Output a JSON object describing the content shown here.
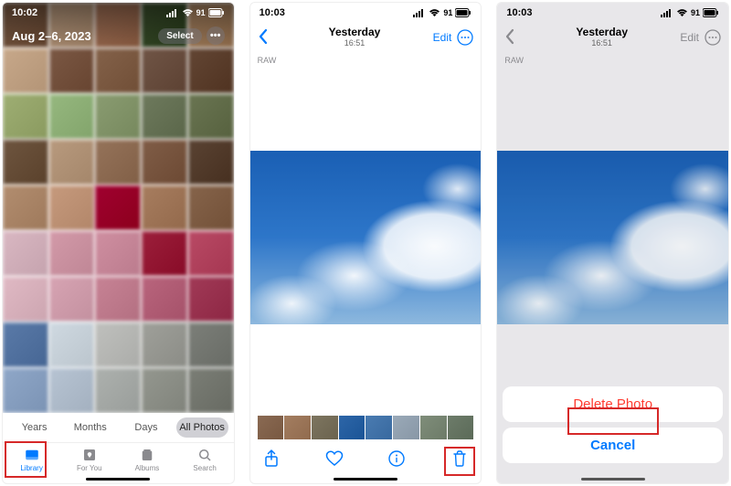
{
  "panel1": {
    "time": "10:02",
    "battery": "91",
    "date_range": "Aug 2–6, 2023",
    "select_label": "Select",
    "segments": {
      "years": "Years",
      "months": "Months",
      "days": "Days",
      "all": "All Photos"
    },
    "tabs": {
      "library": "Library",
      "for_you": "For You",
      "albums": "Albums",
      "search": "Search"
    }
  },
  "panel2": {
    "time": "10:03",
    "battery": "91",
    "title": "Yesterday",
    "subtitle": "16:51",
    "edit_label": "Edit",
    "raw_badge": "RAW"
  },
  "panel3": {
    "time": "10:03",
    "battery": "91",
    "title": "Yesterday",
    "subtitle": "16:51",
    "edit_label": "Edit",
    "raw_badge": "RAW",
    "delete_label": "Delete Photo",
    "cancel_label": "Cancel"
  },
  "grid_colors": [
    "#7a5a44",
    "#b3957a",
    "#9d6e54",
    "#3a4d2c",
    "#a4805f",
    "#c7a88a",
    "#7b5844",
    "#84624a",
    "#705546",
    "#634634",
    "#9eae73",
    "#96b87f",
    "#8a9c71",
    "#6e7a5d",
    "#6a7552",
    "#6e553f",
    "#b89a7e",
    "#95735a",
    "#805d47",
    "#5a4333",
    "#b28d6f",
    "#c69a7d",
    "#a00030",
    "#a77d5f",
    "#86644b",
    "#d9b7c2",
    "#d39aa9",
    "#cf8fa1",
    "#9c1f3b",
    "#b94a65",
    "#e0b9c4",
    "#d7a4b3",
    "#c78395",
    "#b9657d",
    "#a13a57",
    "#5a7aa8",
    "#cfd9e1",
    "#bfc0bd",
    "#9fa09a",
    "#7c7f79",
    "#8fa7c8",
    "#b7c4d3",
    "#adb1ae",
    "#94978f",
    "#7b7e76"
  ],
  "filmstrip_colors": [
    "#8a6a53",
    "#a37d60",
    "#7d7560",
    "#2d66a8",
    "#4a7bb1",
    "#9aa9b8",
    "#7f8d7a",
    "#6d7c6a"
  ]
}
